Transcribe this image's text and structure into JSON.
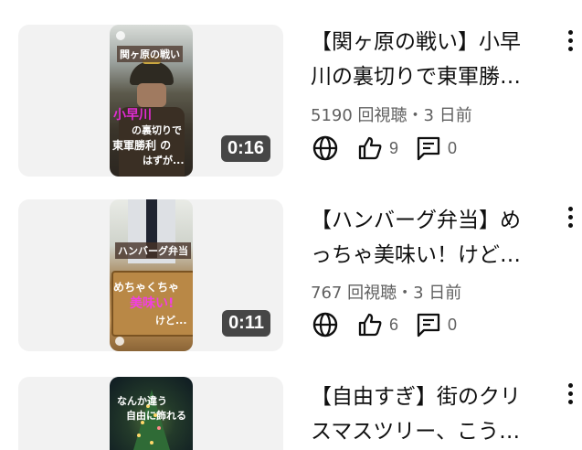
{
  "videos": [
    {
      "title_line1": "【関ヶ原の戦い】小早",
      "title_line2": "川の裏切りで東軍勝…",
      "meta": "5190 回視聴・3 日前",
      "duration": "0:16",
      "likes": "9",
      "comments": "0",
      "overlay": [
        "関ヶ原の戦い",
        "小早川",
        "の裏切りで",
        "東軍勝利 の",
        "はずが..."
      ]
    },
    {
      "title_line1": "【ハンバーグ弁当】め",
      "title_line2": "っちゃ美味い！けど…",
      "meta": "767 回視聴・3 日前",
      "duration": "0:11",
      "likes": "6",
      "comments": "0",
      "overlay": [
        "ハンバーグ弁当",
        "めちゃくちゃ",
        "美味い!",
        "けど..."
      ]
    },
    {
      "title_line1": "【自由すぎ】街のクリ",
      "title_line2": "スマスツリー、こう…",
      "overlay": [
        "なんか違う",
        "自由に飾れる"
      ]
    }
  ]
}
